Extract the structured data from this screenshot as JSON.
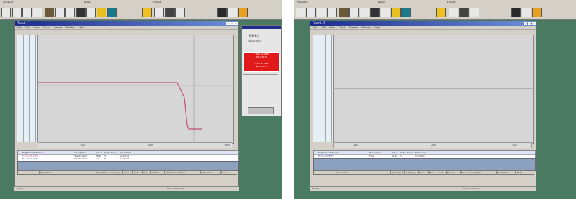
{
  "screens": [
    {
      "top_bar": {
        "left": "Student",
        "mid": "Team",
        "right": "Client"
      },
      "window_title": "Trend - 1",
      "menu": [
        "File",
        "Edit",
        "View",
        "Chart",
        "Format",
        "Window",
        "Help"
      ],
      "x_ticks": [
        "100",
        "200",
        "300"
      ],
      "legend_headers": [
        "Tag/Name Reference",
        "Description",
        "Value",
        "Units",
        "Scale",
        "Timestamp"
      ],
      "legend_rows": [
        {
          "tag": "FT-101/OUT/PV",
          "desc": "Flow Control",
          "value": "50.0",
          "units": "%",
          "time": "12:00:00"
        },
        {
          "tag": "FT-102/OUT/PV",
          "desc": "Flow Control",
          "value": "0.0",
          "units": "%",
          "time": "12:00:00"
        }
      ],
      "bottom_headers": [
        "Item Name",
        "Event Type",
        "Category",
        "Area",
        "Node",
        "Unit",
        "Module",
        "Module Description",
        "Parameter",
        "State"
      ],
      "side_panel": {
        "title": "PID-101",
        "sub": "Flow Control",
        "alarm1_a": "HIGH ALARM",
        "alarm1_b": "FIC-101 HI",
        "alarm2_a": "LOW ALARM",
        "alarm2_b": "FIC-101 LO"
      },
      "status_left": "Ready",
      "status_right": "Process Network"
    },
    {
      "top_bar": {
        "left": "Student",
        "mid": "Team",
        "right": "Client"
      },
      "window_title": "Trend - 2",
      "menu": [
        "File",
        "Edit",
        "View",
        "Chart",
        "Format",
        "Window",
        "Help"
      ],
      "x_ticks": [
        "100",
        "200",
        "300"
      ],
      "legend_headers": [
        "Tag/Name Reference",
        "Description",
        "Value",
        "Units",
        "Scale",
        "Timestamp"
      ],
      "legend_rows": [
        {
          "tag": "FT-201/OUT/PV",
          "desc": "Flow",
          "value": "50.0",
          "units": "%",
          "time": "12:00:00"
        }
      ],
      "bottom_headers": [
        "Item Name",
        "Event Type",
        "Category",
        "Area",
        "Node",
        "Unit",
        "Module",
        "Module Description",
        "Parameter",
        "State"
      ],
      "status_left": "Ready",
      "status_right": "Process Network"
    }
  ],
  "colors": {
    "desktop": "#4b7a62",
    "trace": "#c0506a",
    "alarm": "#e01a1a"
  }
}
